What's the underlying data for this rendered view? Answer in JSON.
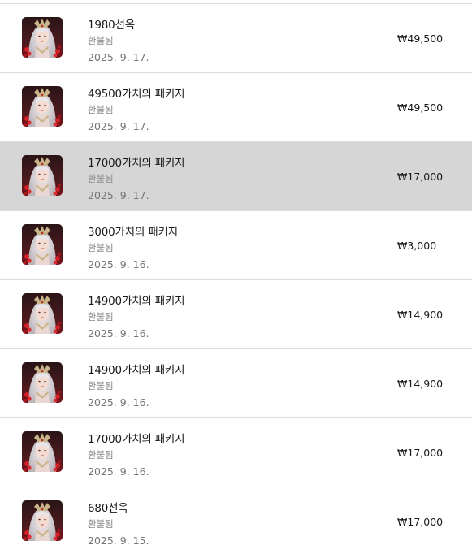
{
  "purchases": [
    {
      "title": "1980선옥",
      "status": "환불됨",
      "date": "2025. 9. 17.",
      "price": "₩49,500",
      "selected": false
    },
    {
      "title": "49500가치의 패키지",
      "status": "환불됨",
      "date": "2025. 9. 17.",
      "price": "₩49,500",
      "selected": false
    },
    {
      "title": "17000가치의 패키지",
      "status": "환불됨",
      "date": "2025. 9. 17.",
      "price": "₩17,000",
      "selected": true
    },
    {
      "title": "3000가치의 패키지",
      "status": "환불됨",
      "date": "2025. 9. 16.",
      "price": "₩3,000",
      "selected": false
    },
    {
      "title": "14900가치의 패키지",
      "status": "환불됨",
      "date": "2025. 9. 16.",
      "price": "₩14,900",
      "selected": false
    },
    {
      "title": "14900가치의 패키지",
      "status": "환불됨",
      "date": "2025. 9. 16.",
      "price": "₩14,900",
      "selected": false
    },
    {
      "title": "17000가치의 패키지",
      "status": "환불됨",
      "date": "2025. 9. 16.",
      "price": "₩17,000",
      "selected": false
    },
    {
      "title": "680선옥",
      "status": "환불됨",
      "date": "2025. 9. 15.",
      "price": "₩17,000",
      "selected": false
    }
  ],
  "icon": "game-character-icon",
  "colors": {
    "selected_row": "#d6d6d6",
    "divider": "#dcdcdc",
    "status_text": "#8a8a8a",
    "date_text": "#757575"
  }
}
